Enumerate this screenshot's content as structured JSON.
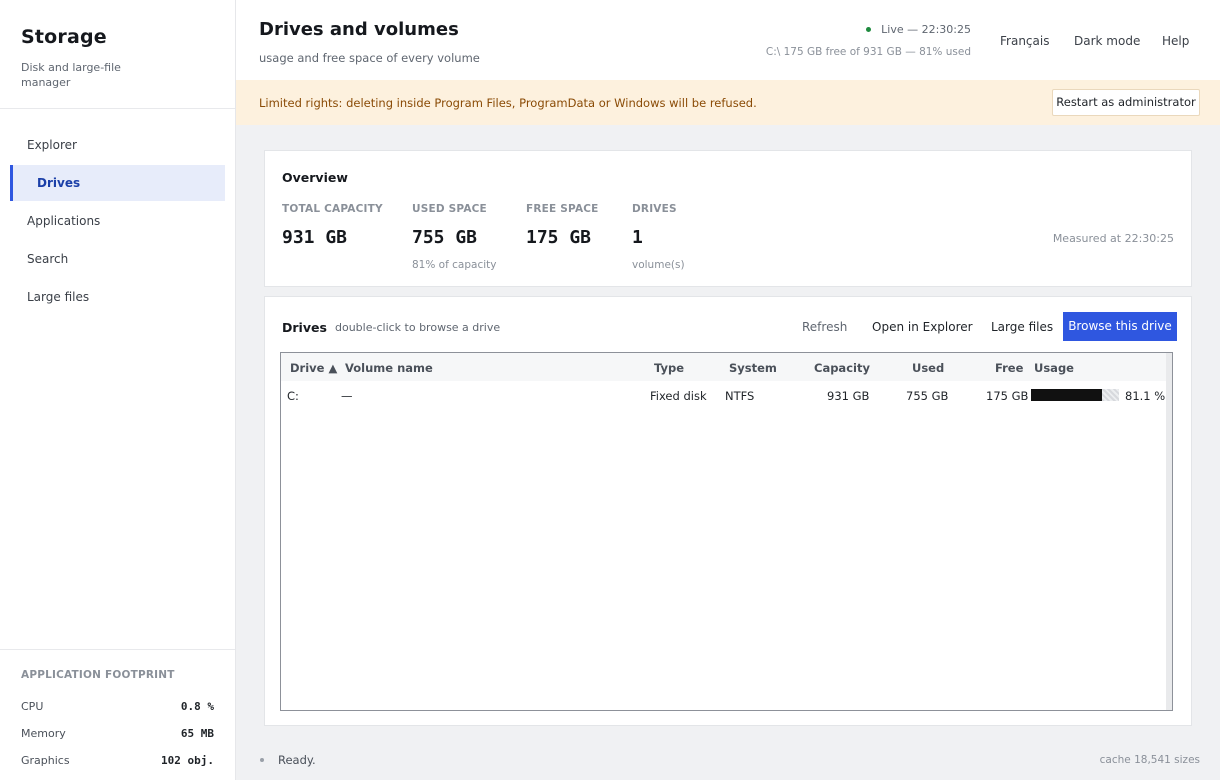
{
  "app": {
    "title": "Storage",
    "subtitle": "Disk and large-file manager"
  },
  "sidebar": {
    "items": [
      {
        "label": "Explorer"
      },
      {
        "label": "Drives",
        "active": true
      },
      {
        "label": "Applications"
      },
      {
        "label": "Search"
      },
      {
        "label": "Large files"
      }
    ],
    "footprint": {
      "heading": "APPLICATION FOOTPRINT",
      "rows": [
        {
          "label": "CPU",
          "value": "0.8 %"
        },
        {
          "label": "Memory",
          "value": "65 MB"
        },
        {
          "label": "Graphics",
          "value": "102 obj."
        }
      ]
    }
  },
  "header": {
    "title": "Drives and volumes",
    "subtitle": "usage and free space of every volume",
    "live": "Live — 22:30:25",
    "live_summary": "C:\\ 175 GB free of 931 GB — 81% used",
    "links": {
      "language": "Français",
      "dark_mode": "Dark mode",
      "help": "Help"
    }
  },
  "banner": {
    "text": "Limited rights: deleting inside Program Files, ProgramData or Windows will be refused.",
    "button": "Restart as administrator"
  },
  "overview": {
    "title": "Overview",
    "stats": [
      {
        "label": "TOTAL CAPACITY",
        "value": "931 GB",
        "note": ""
      },
      {
        "label": "USED SPACE",
        "value": "755 GB",
        "note": "81% of capacity"
      },
      {
        "label": "FREE SPACE",
        "value": "175 GB",
        "note": ""
      },
      {
        "label": "DRIVES",
        "value": "1",
        "note": "volume(s)"
      }
    ],
    "measured": "Measured at 22:30:25"
  },
  "drives": {
    "title": "Drives",
    "hint": "double-click to browse a drive",
    "toolbar": {
      "refresh": "Refresh",
      "open_explorer": "Open in Explorer",
      "large_files": "Large files",
      "browse": "Browse this drive"
    },
    "columns": {
      "drive": "Drive ▲",
      "volume": "Volume name",
      "type": "Type",
      "system": "System",
      "capacity": "Capacity",
      "used": "Used",
      "free": "Free",
      "usage": "Usage"
    },
    "rows": [
      {
        "drive": "C:",
        "volume": "—",
        "type": "Fixed disk",
        "system": "NTFS",
        "capacity": "931 GB",
        "used": "755 GB",
        "free": "175 GB",
        "usage_fraction": 0.811,
        "usage_label": "81.1 %"
      }
    ]
  },
  "status": {
    "text": "Ready.",
    "cache": "cache 18,541 sizes"
  },
  "colors": {
    "accent": "#2f57e0",
    "banner_bg": "#fdf1de",
    "banner_text": "#8a4b06",
    "live": "#1e8a3e"
  }
}
